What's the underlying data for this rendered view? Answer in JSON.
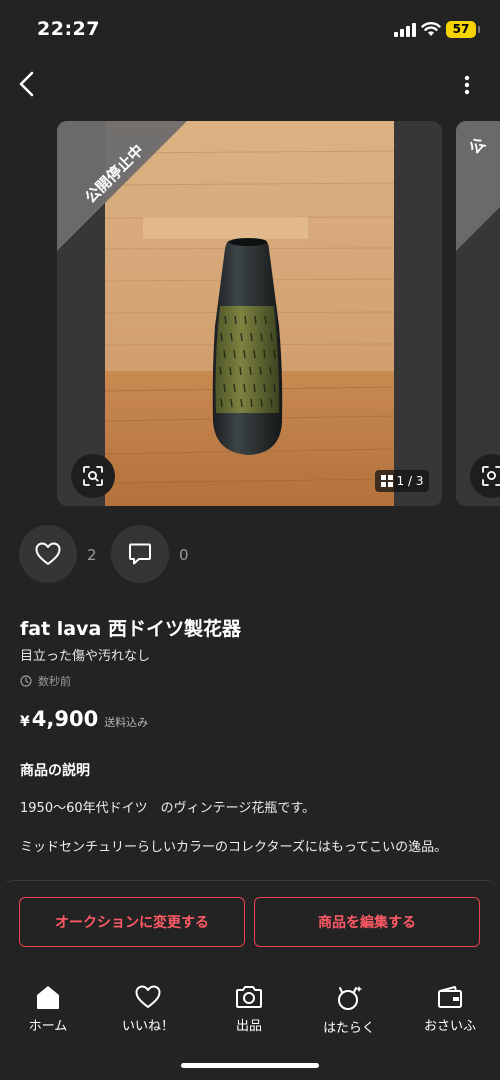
{
  "status_bar": {
    "time": "22:27",
    "battery": "57"
  },
  "photo": {
    "banner": "公開停止中",
    "counter": "1 / 3",
    "next_banner": "公"
  },
  "social": {
    "likes": "2",
    "comments": "0"
  },
  "item": {
    "title": "fat lava 西ドイツ製花器",
    "condition": "目立った傷や汚れなし",
    "posted": "数秒前",
    "price_symbol": "¥",
    "price": "4,900",
    "shipping": "送料込み"
  },
  "description": {
    "heading": "商品の説明",
    "lines": [
      "1950〜60年代ドイツ　のヴィンテージ花瓶です。",
      "ミッドセンチュリーらしいカラーのコレクターズにはもってこいの逸品。"
    ]
  },
  "actions": {
    "auction": "オークションに変更する",
    "edit": "商品を編集する"
  },
  "tabs": [
    "ホーム",
    "いいね！",
    "出品",
    "はたらく",
    "おさいふ"
  ],
  "colors": {
    "accent": "#e8434f",
    "background": "#232323",
    "battery": "#f5d400"
  }
}
